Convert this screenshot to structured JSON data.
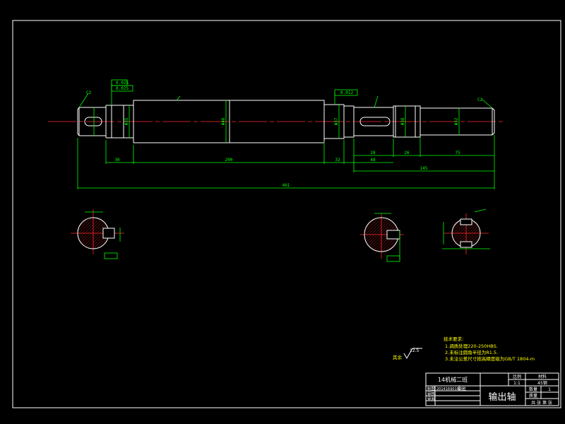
{
  "drawing": {
    "dims": {
      "overall": "461",
      "seg_30": "30",
      "seg_200": "200",
      "seg_32": "32",
      "seg_48": "48",
      "seg_28": "28",
      "seg_26": "26",
      "seg_75": "75",
      "seg_145": "145",
      "dia_main": "Φ46",
      "dia_left": "Φ35",
      "dia_mid": "Φ37",
      "dia_right_bearing": "Φ38",
      "dia_right": "Φ32",
      "chamfer_left": "C2",
      "chamfer_right": "C2"
    },
    "gdt": {
      "g1": "0.025",
      "g2": "0.025",
      "g3": "0.012"
    },
    "notes": {
      "title": "技术要求:",
      "line1": "1.调质处理220-250HBS.",
      "line2": "2.未标注圆角半径为R1.5.",
      "line3": "3.未注公差尺寸按高精度级为GB/T 1804-m"
    },
    "roughness": {
      "label": "其余",
      "value": "12.5"
    }
  },
  "title_block": {
    "class": "14机械二班",
    "scale_label": "比例",
    "scale_value": "1:1",
    "material_label": "材料",
    "material_value": "45钢",
    "designer_label": "制图",
    "designer_value": "2014169018胡胜",
    "check_label": "审核",
    "review_label": "审阅",
    "part_name": "输出轴",
    "qty_label": "数量",
    "qty_value": "1",
    "weight_label": "质量",
    "sheet_label": "共 张 第 张"
  },
  "colors": {
    "outline": "#ffffff",
    "dimension": "#00ff00",
    "centerline": "#ff2a2a",
    "notes": "#ffff00"
  }
}
